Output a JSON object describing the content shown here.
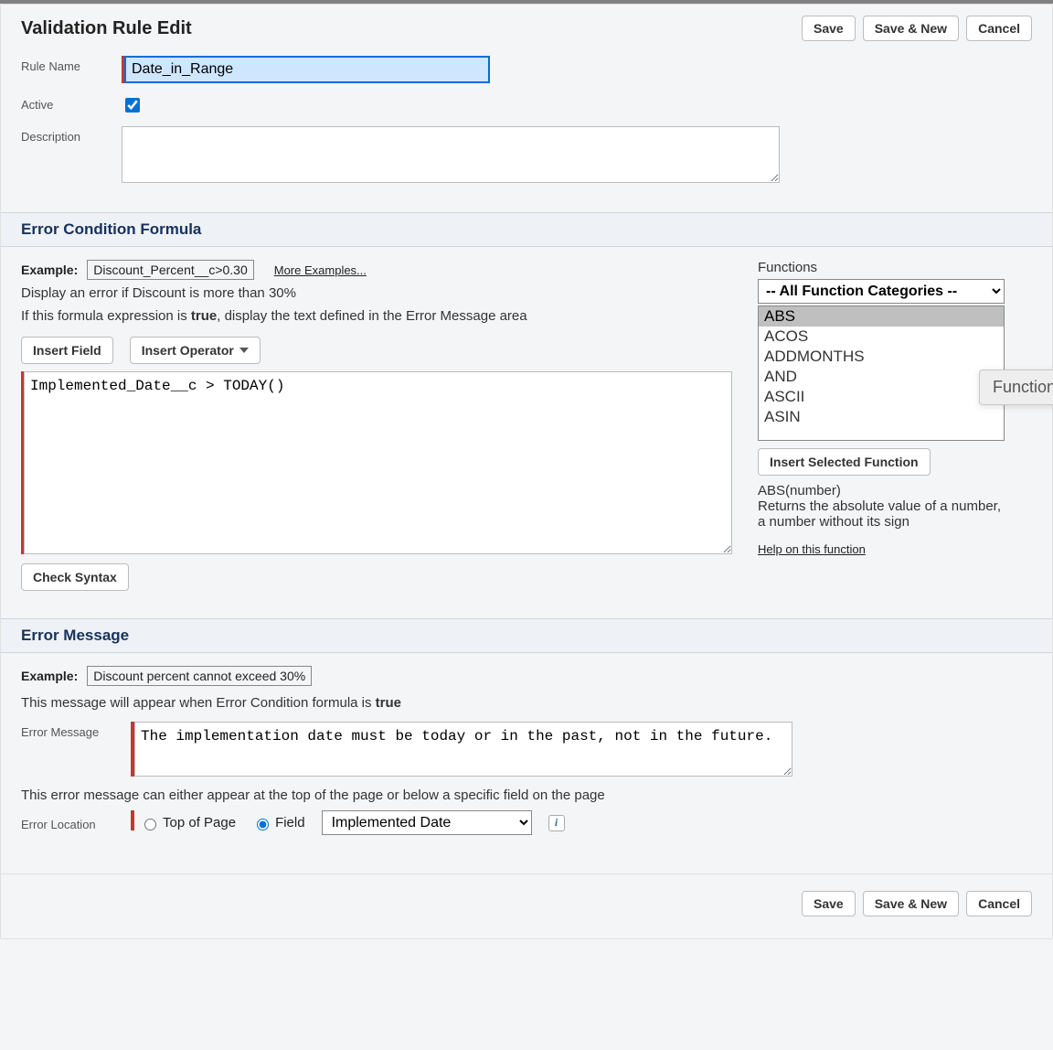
{
  "header": {
    "title": "Validation Rule Edit",
    "buttons": {
      "save": "Save",
      "save_new": "Save & New",
      "cancel": "Cancel"
    }
  },
  "basic": {
    "rule_name_label": "Rule Name",
    "rule_name_value": "Date_in_Range",
    "active_label": "Active",
    "active_checked": true,
    "description_label": "Description",
    "description_value": ""
  },
  "formula_section": {
    "title": "Error Condition Formula",
    "example_label": "Example:",
    "example_code": "Discount_Percent__c>0.30",
    "more_examples": "More Examples...",
    "example_desc": "Display an error if Discount is more than 30%",
    "instruction_pre": "If this formula expression is ",
    "instruction_bold": "true",
    "instruction_post": ", display the text defined in the Error Message area",
    "insert_field": "Insert Field",
    "insert_operator": "Insert Operator",
    "formula_value": "Implemented_Date__c > TODAY()",
    "check_syntax": "Check Syntax",
    "functions_label": "Functions",
    "category_selected": "-- All Function Categories --",
    "function_items": [
      "ABS",
      "ACOS",
      "ADDMONTHS",
      "AND",
      "ASCII",
      "ASIN"
    ],
    "selected_function_index": 0,
    "insert_selected": "Insert Selected Function",
    "signature": "ABS(number)",
    "signature_desc": "Returns the absolute value of a number, a number without its sign",
    "help_link": "Help on this function",
    "tooltip": "Functions"
  },
  "error_section": {
    "title": "Error Message",
    "example_label": "Example:",
    "example_text": "Discount percent cannot exceed 30%",
    "note_pre": "This message will appear when Error Condition formula is ",
    "note_bold": "true",
    "error_message_label": "Error Message",
    "error_message_value": "The implementation date must be today or in the past, not in the future.",
    "location_intro": "This error message can either appear at the top of the page or below a specific field on the page",
    "error_location_label": "Error Location",
    "radio_top": "Top of Page",
    "radio_field": "Field",
    "field_select_value": "Implemented Date"
  },
  "footer": {
    "save": "Save",
    "save_new": "Save & New",
    "cancel": "Cancel"
  }
}
